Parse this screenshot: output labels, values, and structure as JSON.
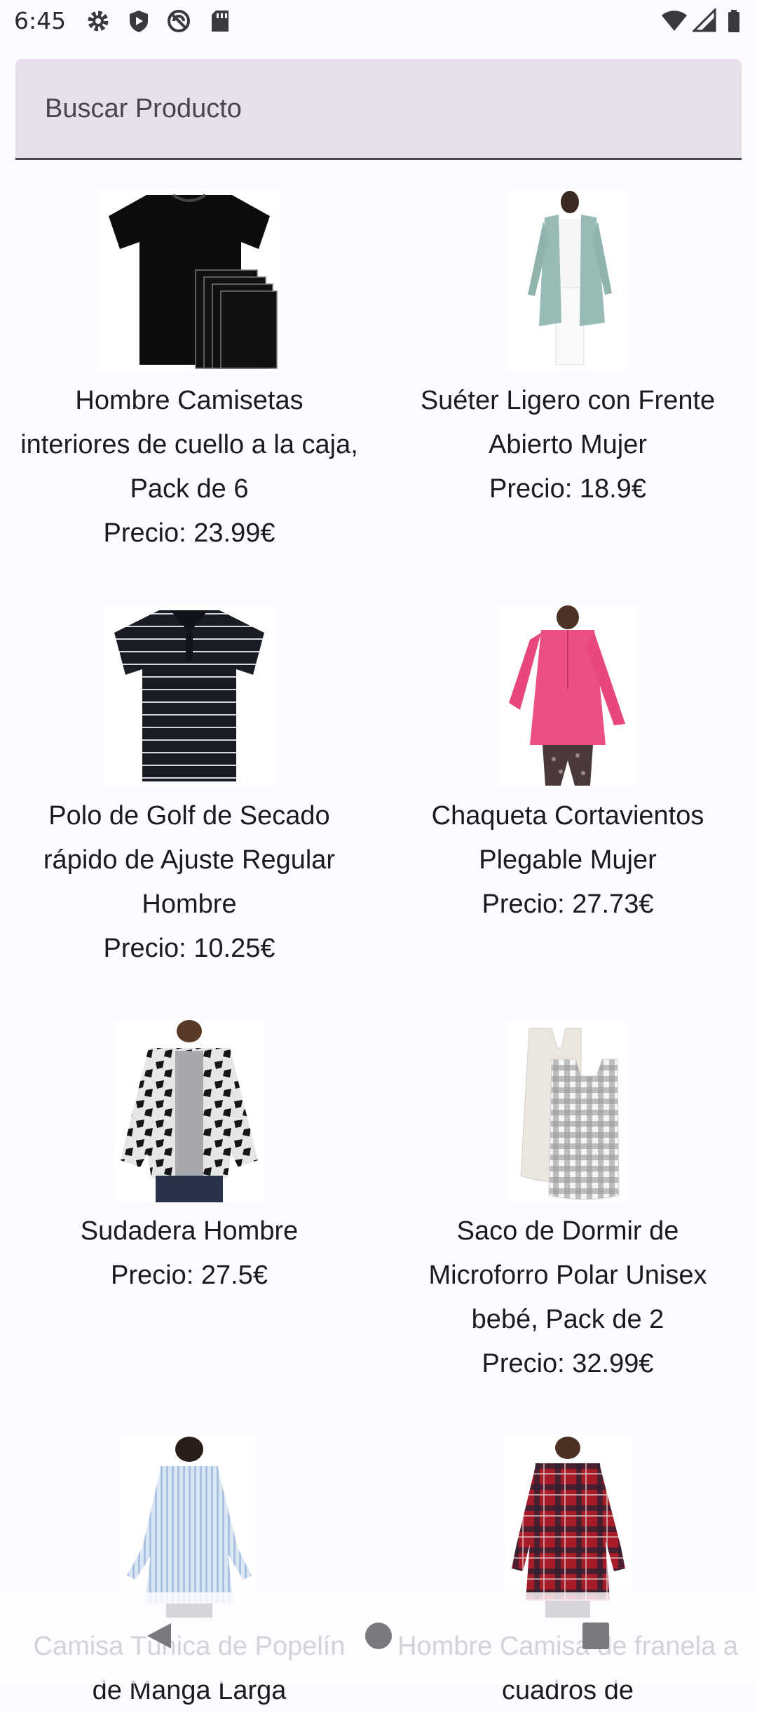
{
  "status_bar": {
    "time": "6:45",
    "left_icons": [
      "settings-icon",
      "shield-icon",
      "do-not-disturb-icon",
      "sd-card-icon"
    ],
    "right_icons": [
      "wifi-icon",
      "signal-icon",
      "battery-icon"
    ]
  },
  "search": {
    "placeholder": "Buscar Producto",
    "value": ""
  },
  "products": [
    {
      "title": "Hombre Camisetas interiores de cuello a la caja, Pack de 6",
      "price": "Precio: 23.99€",
      "image": "black-tshirt-pack"
    },
    {
      "title": "Suéter Ligero con Frente Abierto Mujer",
      "price": "Precio: 18.9€",
      "image": "mint-cardigan"
    },
    {
      "title": "Polo de Golf de Secado rápido de Ajuste Regular Hombre",
      "price": "Precio: 10.25€",
      "image": "striped-polo"
    },
    {
      "title": "Chaqueta Cortavientos Plegable Mujer",
      "price": "Precio: 27.73€",
      "image": "pink-windbreaker"
    },
    {
      "title": "Sudadera Hombre",
      "price": "Precio: 27.5€",
      "image": "patterned-hoodie"
    },
    {
      "title": "Saco de Dormir de Microforro Polar Unisex bebé, Pack de 2",
      "price": "Precio: 32.99€",
      "image": "baby-sleep-sacks"
    },
    {
      "title": "Camisa Túnica de Popelín de Manga Larga",
      "price": "",
      "image": "blue-striped-tunic"
    },
    {
      "title": "Hombre Camisa de franela a cuadros de",
      "price": "",
      "image": "red-plaid-shirt"
    }
  ],
  "nav": {
    "icons": [
      "back-icon",
      "home-icon",
      "recents-icon"
    ]
  }
}
